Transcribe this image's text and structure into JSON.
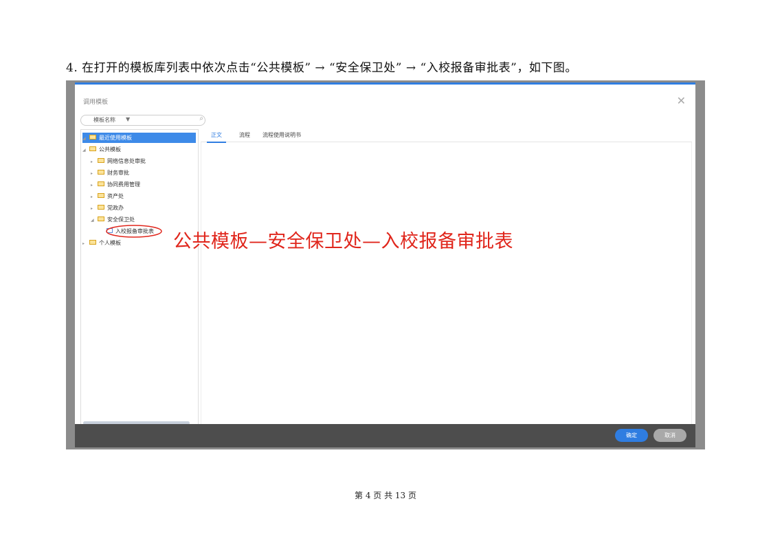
{
  "instruction": "4. 在打开的模板库列表中依次点击“公共模板” → “安全保卫处” → “入校报备审批表”，如下图。",
  "dialog": {
    "title": "调用模板",
    "search_label": "模板名称",
    "tree": {
      "recent": "最近使用模板",
      "public": "公共模板",
      "items": [
        "网络信息处审批",
        "财务审批",
        "协同费用管理",
        "资产处",
        "党政办",
        "安全保卫处"
      ],
      "selected_doc": "入校报备审批表",
      "personal": "个人模板"
    },
    "tabs": [
      "正文",
      "流程",
      "流程使用说明书"
    ],
    "buttons": {
      "ok": "确定",
      "cancel": "取消"
    }
  },
  "annotation": "公共模板—安全保卫处—入校报备审批表",
  "page_number": "第 4 页 共 13 页",
  "colors": {
    "accent": "#2f7de1",
    "annotation": "#e0261c",
    "footer": "#4d4d4d"
  }
}
